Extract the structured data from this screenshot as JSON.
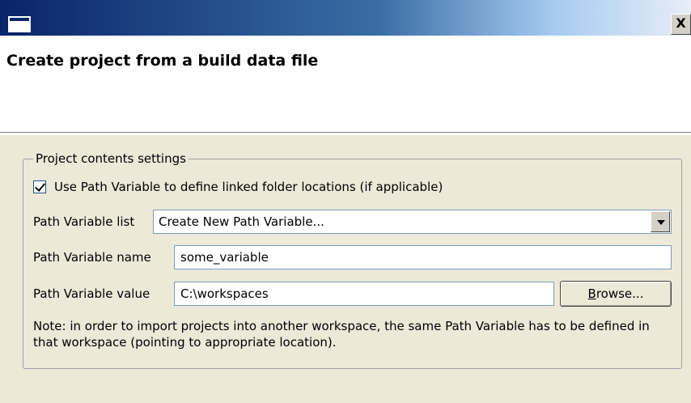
{
  "window": {
    "close_label": "X"
  },
  "header": {
    "title": "Create project from a build data file"
  },
  "group": {
    "legend": "Project contents settings",
    "checkbox": {
      "label": "Use Path Variable to define linked folder locations (if applicable)",
      "checked": true
    },
    "path_variable_list": {
      "label": "Path Variable list",
      "selected": "Create New Path Variable..."
    },
    "path_variable_name": {
      "label": "Path Variable name",
      "value": "some_variable"
    },
    "path_variable_value": {
      "label": "Path Variable value",
      "value": "C:\\workspaces"
    },
    "browse": {
      "mnemonic": "B",
      "rest": "rowse..."
    },
    "note": "Note: in order to import projects into another workspace, the same Path Variable has to be defined in that workspace (pointing to appropriate location)."
  }
}
